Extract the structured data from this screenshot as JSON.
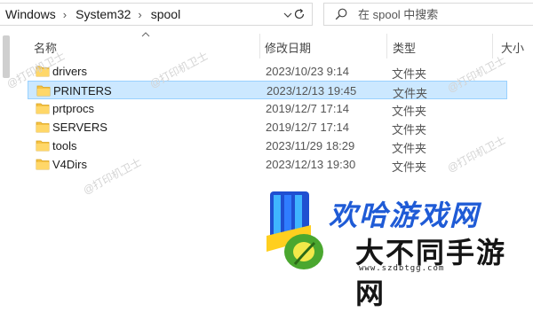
{
  "address": {
    "crumbs": [
      "Windows",
      "System32",
      "spool"
    ],
    "separator": "›"
  },
  "search": {
    "placeholder": "在 spool 中搜索"
  },
  "columns": {
    "name": "名称",
    "date": "修改日期",
    "type": "类型",
    "size": "大小"
  },
  "files": [
    {
      "name": "drivers",
      "date": "2023/10/23 9:14",
      "type": "文件夹",
      "selected": false
    },
    {
      "name": "PRINTERS",
      "date": "2023/12/13 19:45",
      "type": "文件夹",
      "selected": true
    },
    {
      "name": "prtprocs",
      "date": "2019/12/7 17:14",
      "type": "文件夹",
      "selected": false
    },
    {
      "name": "SERVERS",
      "date": "2019/12/7 17:14",
      "type": "文件夹",
      "selected": false
    },
    {
      "name": "tools",
      "date": "2023/11/29 18:29",
      "type": "文件夹",
      "selected": false
    },
    {
      "name": "V4Dirs",
      "date": "2023/12/13 19:30",
      "type": "文件夹",
      "selected": false
    }
  ],
  "watermark": "@打印机卫士",
  "site_logo": {
    "top": "欢哈游戏网",
    "main": "大不同手游网",
    "url": "www.szdbtgg.com"
  },
  "colors": {
    "selected_bg": "#cce8ff",
    "selected_border": "#99d1ff",
    "folder": "#f5c243"
  }
}
